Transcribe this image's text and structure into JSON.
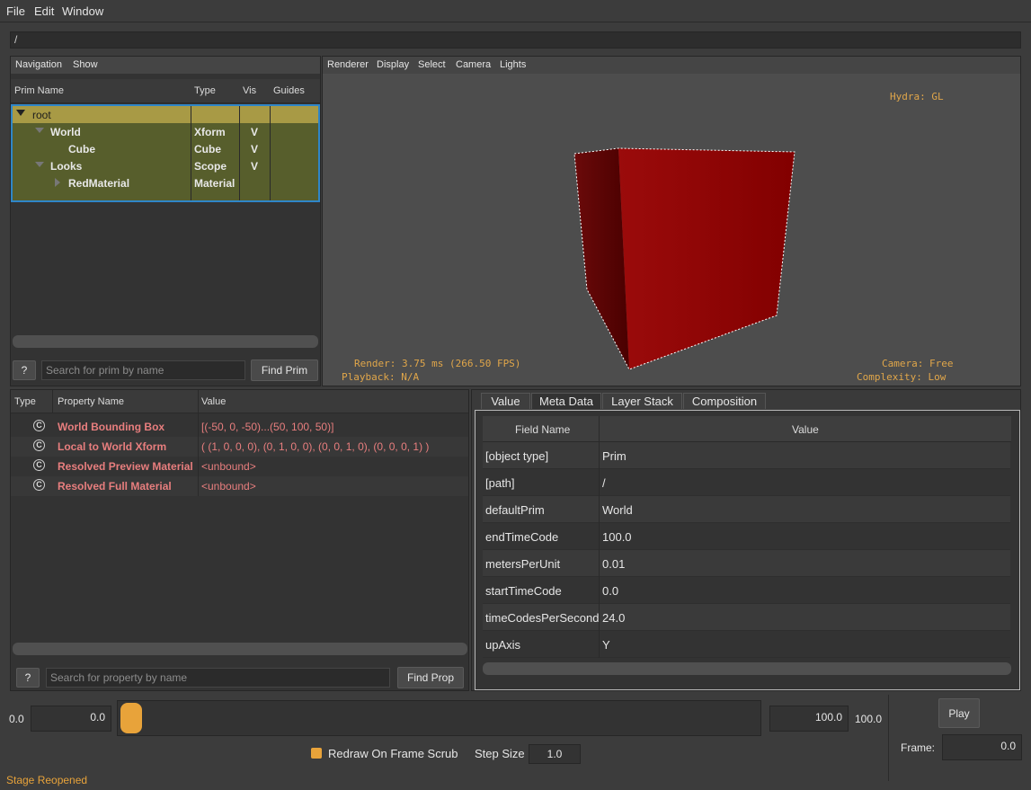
{
  "menu": {
    "file": "File",
    "edit": "Edit",
    "window": "Window"
  },
  "path": "/",
  "nav": {
    "menu_navigation": "Navigation",
    "menu_show": "Show",
    "columns": {
      "prim_name": "Prim Name",
      "type": "Type",
      "vis": "Vis",
      "guides": "Guides"
    },
    "rows": [
      {
        "name": "root",
        "type": "",
        "vis": ""
      },
      {
        "name": "World",
        "type": "Xform",
        "vis": "V"
      },
      {
        "name": "Cube",
        "type": "Cube",
        "vis": "V"
      },
      {
        "name": "Looks",
        "type": "Scope",
        "vis": "V"
      },
      {
        "name": "RedMaterial",
        "type": "Material",
        "vis": ""
      }
    ],
    "help_label": "?",
    "search_placeholder": "Search for prim by name",
    "find_label": "Find Prim"
  },
  "viewport": {
    "menu": {
      "renderer": "Renderer",
      "display": "Display",
      "select": "Select",
      "camera": "Camera",
      "lights": "Lights"
    },
    "hydra": "Hydra: GL",
    "render": "Render: 3.75 ms (266.50 FPS)",
    "playback": "Playback: N/A",
    "camera": "Camera: Free",
    "complexity": "Complexity: Low"
  },
  "properties": {
    "columns": {
      "type": "Type",
      "name": "Property Name",
      "value": "Value"
    },
    "icon_glyph": "C",
    "rows": [
      {
        "name": "World Bounding Box",
        "value": "[(-50, 0, -50)...(50, 100, 50)]"
      },
      {
        "name": "Local to World Xform",
        "value": "( (1, 0, 0, 0), (0, 1, 0, 0), (0, 0, 1, 0), (0, 0, 0, 1) )"
      },
      {
        "name": "Resolved Preview Material",
        "value": "<unbound>"
      },
      {
        "name": "Resolved Full Material",
        "value": "<unbound>"
      }
    ],
    "help_label": "?",
    "search_placeholder": "Search for property by name",
    "find_label": "Find Prop"
  },
  "metadata": {
    "tabs": [
      "Value",
      "Meta Data",
      "Layer Stack",
      "Composition"
    ],
    "columns": {
      "field": "Field Name",
      "value": "Value"
    },
    "rows": [
      {
        "field": "[object type]",
        "value": "Prim"
      },
      {
        "field": "[path]",
        "value": "/"
      },
      {
        "field": "defaultPrim",
        "value": "World"
      },
      {
        "field": "endTimeCode",
        "value": "100.0"
      },
      {
        "field": "metersPerUnit",
        "value": "0.01"
      },
      {
        "field": "startTimeCode",
        "value": "0.0"
      },
      {
        "field": "timeCodesPerSecond",
        "value": "24.0"
      },
      {
        "field": "upAxis",
        "value": "Y"
      }
    ]
  },
  "timeline": {
    "range_start_label": "0.0",
    "start_value": "0.0",
    "end_value": "100.0",
    "range_end_label": "100.0",
    "play_label": "Play",
    "frame_label": "Frame:",
    "frame_value": "0.0",
    "redraw_label": "Redraw On Frame Scrub",
    "step_label": "Step Size",
    "step_value": "1.0",
    "accent": "#e8a33a"
  },
  "status": "Stage Reopened",
  "colors": {
    "selection_bg": "#575e2c",
    "root_bg": "#a89a45",
    "selection_border": "#2f86c8",
    "cube_red": "#8b0000",
    "hud": "#e0a64a"
  }
}
